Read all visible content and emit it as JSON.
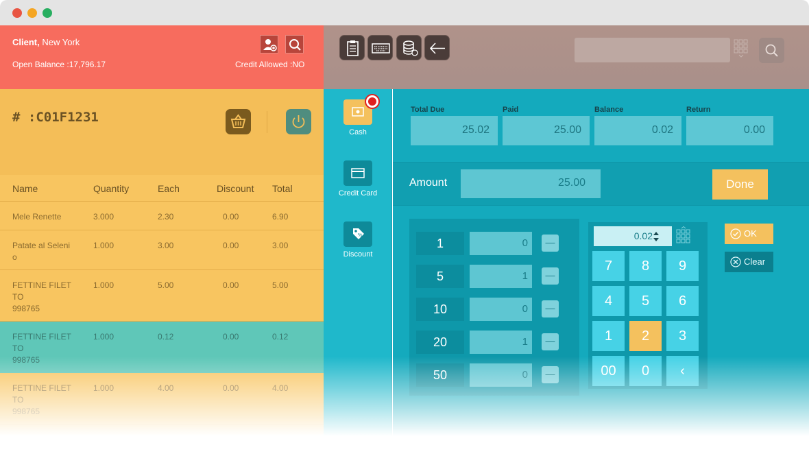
{
  "window": {
    "dot_colors": [
      "#e85543",
      "#f5a623",
      "#27ae60"
    ]
  },
  "client": {
    "label": "Client,",
    "city": "New York",
    "open_balance": "Open Balance :17,796.17",
    "credit_allowed": "Credit Allowed :NO"
  },
  "order": {
    "number": "# :C01F1231"
  },
  "table": {
    "headers": [
      "Name",
      "Quantity",
      "Each",
      "Discount",
      "Total"
    ],
    "rows": [
      {
        "name": "Mele Renette",
        "quantity": "3.000",
        "each": "2.30",
        "discount": "0.00",
        "total": "6.90"
      },
      {
        "name": "Patate al Seleni\no",
        "quantity": "1.000",
        "each": "3.00",
        "discount": "0.00",
        "total": "3.00"
      },
      {
        "name": "FETTINE FILET\nTO\n998765",
        "quantity": "1.000",
        "each": "5.00",
        "discount": "0.00",
        "total": "5.00"
      },
      {
        "name": "FETTINE FILET\nTO\n998765",
        "quantity": "1.000",
        "each": "0.12",
        "discount": "0.00",
        "total": "0.12",
        "selected": true
      },
      {
        "name": "FETTINE FILET\nTO\n998765",
        "quantity": "1.000",
        "each": "4.00",
        "discount": "0.00",
        "total": "4.00"
      }
    ]
  },
  "sidebar": {
    "items": [
      {
        "label": "Cash",
        "icon": "cash-icon",
        "active": true
      },
      {
        "label": "Credit Card",
        "icon": "credit-card-icon"
      },
      {
        "label": "Discount",
        "icon": "discount-tag-icon"
      }
    ]
  },
  "totals": {
    "total_due_label": "Total Due",
    "total_due": "25.02",
    "paid_label": "Paid",
    "paid": "25.00",
    "balance_label": "Balance",
    "balance": "0.02",
    "return_label": "Return",
    "return": "0.00"
  },
  "amount": {
    "label": "Amount",
    "value": "25.00",
    "done_label": "Done"
  },
  "denominations": [
    {
      "label": "1",
      "value": "0"
    },
    {
      "label": "5",
      "value": "1"
    },
    {
      "label": "10",
      "value": "0"
    },
    {
      "label": "20",
      "value": "1"
    },
    {
      "label": "50",
      "value": "0"
    }
  ],
  "keypad": {
    "input_value": "0.02",
    "keys": [
      "7",
      "8",
      "9",
      "4",
      "5",
      "6",
      "1",
      "2",
      "3",
      "00",
      "0",
      "‹"
    ]
  },
  "actions": {
    "ok_label": "OK",
    "clear_label": "Clear"
  },
  "colors": {
    "client_bar": "#f76c5e",
    "order_bar": "#f4be58",
    "selected_row": "#5fc7b8",
    "payment_area": "#14aabd",
    "accent_yellow": "#f4c15e"
  }
}
